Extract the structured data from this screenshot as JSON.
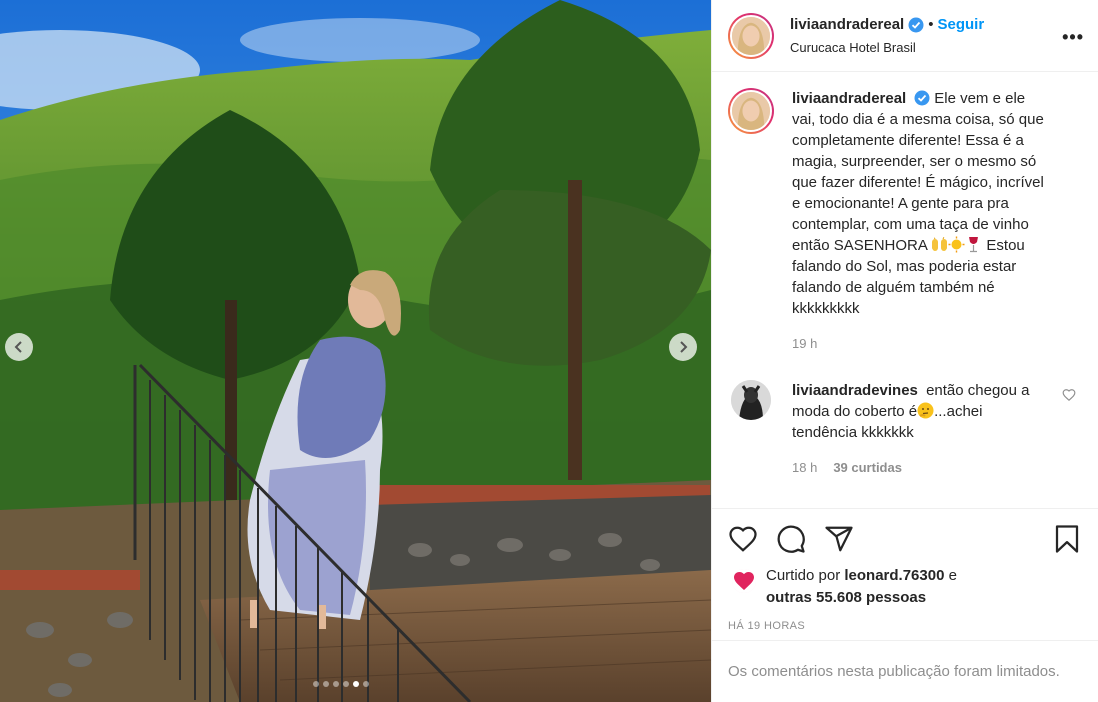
{
  "post": {
    "username": "liviaandradereal",
    "follow_label": "Seguir",
    "bullet": "•",
    "location": "Curucaca Hotel Brasil",
    "more": "•••"
  },
  "caption": {
    "username": "liviaandradereal",
    "text_part1": "Ele vem e ele vai, todo dia é a mesma coisa, só que completamente diferente! Essa é a magia, surpreender, ser o mesmo só que fazer diferente! É mágico, incrível e emocionante! A gente para pra contemplar, com uma taça de vinho então SASENHORA",
    "text_part2": "Estou falando do Sol, mas poderia estar falando de alguém também né kkkkkkkkk",
    "emojis": [
      "raising-hands",
      "sun",
      "wine-glass"
    ],
    "age": "19 h"
  },
  "reply": {
    "username": "liviaandradevines",
    "text_part1": "então chegou a moda do coberto é",
    "text_part2": "...achei tendência kkkkkkk",
    "emoji": "thinking-face",
    "age": "18 h",
    "likes": "39 curtidas"
  },
  "likes": {
    "prefix": "Curtido por",
    "user": "leonard.76300",
    "mid": "e",
    "others": "outras 55.608 pessoas"
  },
  "timestamp": "HÁ 19 HORAS",
  "comments_limited": "Os comentários nesta publicação foram limitados.",
  "carousel": {
    "count": 6,
    "active_index": 4
  },
  "icons": [
    "verified-badge-icon",
    "heart-icon",
    "comment-icon",
    "share-icon",
    "bookmark-icon",
    "chevron-left-icon",
    "chevron-right-icon"
  ],
  "colors": {
    "accent": "#0095f6",
    "text": "#262626",
    "muted": "#8e8e8e",
    "border": "#efefef"
  }
}
